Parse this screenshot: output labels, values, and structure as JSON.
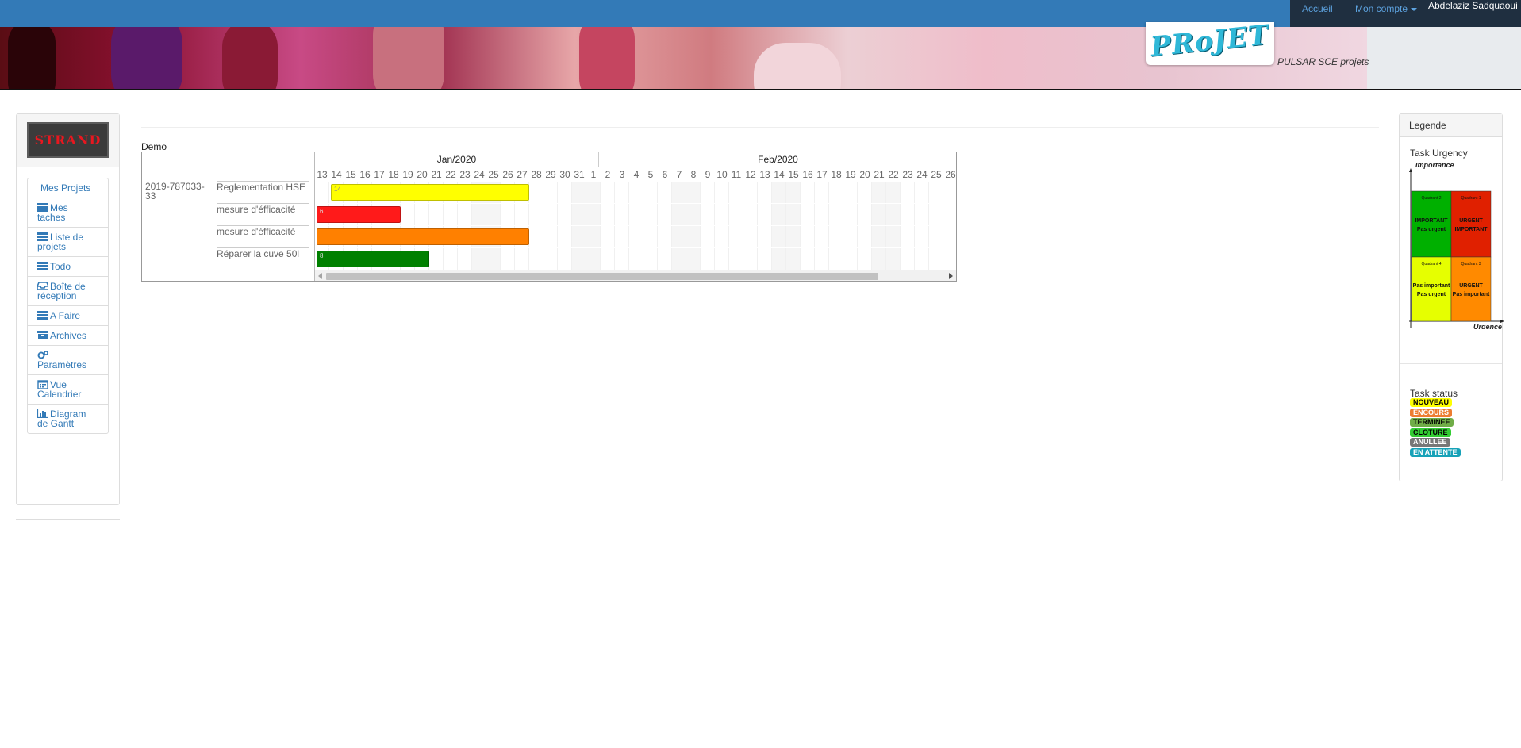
{
  "nav": {
    "home": "Accueil",
    "account": "Mon compte",
    "user": "Abdelaziz Sadquaoui"
  },
  "header": {
    "logo_text": "PRoJET",
    "subtitle": "PULSAR SCE projets"
  },
  "sidebar": {
    "company_logo": "STRAND",
    "items": [
      {
        "label": "Mes Projets",
        "icon": ""
      },
      {
        "label": "Mes taches",
        "icon": "list-icon"
      },
      {
        "label": "Liste de projets",
        "icon": "list-icon"
      },
      {
        "label": "Todo",
        "icon": "list-icon"
      },
      {
        "label": "Boîte de réception",
        "icon": "inbox-icon"
      },
      {
        "label": "A Faire",
        "icon": "list-icon"
      },
      {
        "label": "Archives",
        "icon": "archive-icon"
      },
      {
        "label": "Paramètres",
        "icon": "gears-icon"
      },
      {
        "label": "Vue Calendrier",
        "icon": "calendar-icon"
      },
      {
        "label": "Diagram de Gantt",
        "icon": "bar-chart-icon"
      }
    ]
  },
  "gantt": {
    "title": "Demo",
    "project_id": "2019-787033-33",
    "months": [
      "Jan/2020",
      "Feb/2020"
    ],
    "days": [
      "13",
      "14",
      "15",
      "16",
      "17",
      "18",
      "19",
      "20",
      "21",
      "22",
      "23",
      "24",
      "25",
      "26",
      "27",
      "28",
      "29",
      "30",
      "31",
      "1",
      "2",
      "3",
      "4",
      "5",
      "6",
      "7",
      "8",
      "9",
      "10",
      "11",
      "12",
      "13",
      "14",
      "15",
      "16",
      "17",
      "18",
      "19",
      "20",
      "21",
      "22",
      "23",
      "24",
      "25",
      "26"
    ],
    "tasks": [
      {
        "name": "Reglementation HSE",
        "start_day_index": 1,
        "duration_days": 14,
        "label": "14",
        "color": "#ffff00"
      },
      {
        "name": "mesure d'éfficacité",
        "start_day_index": 0,
        "duration_days": 6,
        "label": "6",
        "color": "#ff1a1a"
      },
      {
        "name": "mesure d'éfficacité",
        "start_day_index": 0,
        "duration_days": 15,
        "label": "",
        "color": "#ff8000"
      },
      {
        "name": "Réparer la cuve 50l",
        "start_day_index": 0,
        "duration_days": 8,
        "label": "8",
        "color": "#008000"
      }
    ]
  },
  "legend": {
    "title": "Legende",
    "urgency_title": "Task Urgency",
    "matrix": {
      "y_axis": "Importance",
      "x_axis": "Urgence",
      "quadrants": [
        {
          "name": "Quadrant 2",
          "text": "IMPORTANT Pas urgent",
          "color": "#00b000"
        },
        {
          "name": "Quadrant 1",
          "text": "URGENT IMPORTANT",
          "color": "#e02000"
        },
        {
          "name": "Quadrant 4",
          "text": "Pas important Pas urgent",
          "color": "#e6ff00"
        },
        {
          "name": "Quadrant 3",
          "text": "URGENT Pas important",
          "color": "#ff8a00"
        }
      ]
    },
    "status_title": "Task status",
    "statuses": [
      {
        "label": "NOUVEAU",
        "bg": "#ffff00",
        "fg": "#000000"
      },
      {
        "label": "ENCOURS",
        "bg": "#ed7d31",
        "fg": "#ffffff"
      },
      {
        "label": "TERMINEE",
        "bg": "#70ad47",
        "fg": "#000000"
      },
      {
        "label": "CLOTURE",
        "bg": "#33cc33",
        "fg": "#000000"
      },
      {
        "label": "ANULLEE",
        "bg": "#777777",
        "fg": "#ffffff"
      },
      {
        "label": "EN ATTENTE",
        "bg": "#17a2b8",
        "fg": "#ffffff"
      }
    ]
  }
}
